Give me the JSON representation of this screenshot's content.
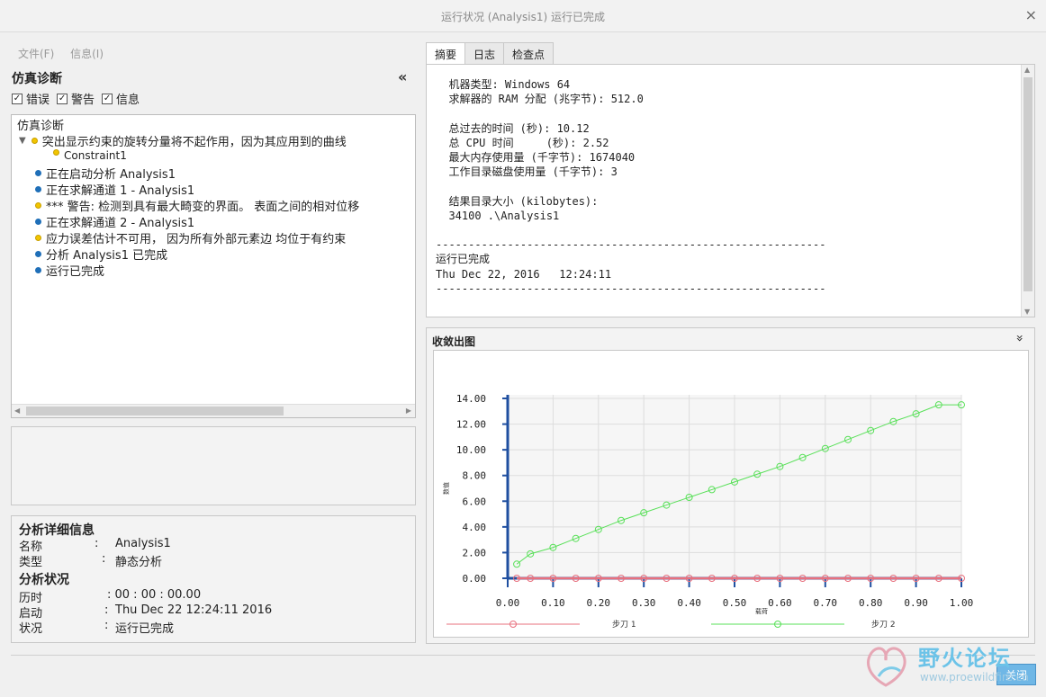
{
  "window": {
    "title": "运行状况 (Analysis1) 运行已完成",
    "close_glyph": "×"
  },
  "menu": {
    "file": "文件(F)",
    "info": "信息(I)"
  },
  "diagnostics": {
    "heading": "仿真诊断",
    "collapse_glyph": "«",
    "filters": {
      "errors": "错误",
      "warnings": "警告",
      "info": "信息"
    },
    "root": "仿真诊断",
    "items": [
      {
        "text": "突出显示约束的旋转分量将不起作用，因为其应用到的曲线",
        "kind": "warning"
      },
      {
        "text": "Constraint1",
        "kind": "warning"
      },
      {
        "text": "正在启动分析 Analysis1",
        "kind": "info"
      },
      {
        "text": "正在求解通道 1 - Analysis1",
        "kind": "info"
      },
      {
        "text": "*** 警告: 检测到具有最大畸变的界面。 表面之间的相对位移",
        "kind": "warning"
      },
      {
        "text": "正在求解通道 2 - Analysis1",
        "kind": "info"
      },
      {
        "text": " 应力误差估计不可用， 因为所有外部元素边 均位于有约束",
        "kind": "warning"
      },
      {
        "text": "分析 Analysis1 已完成",
        "kind": "info"
      },
      {
        "text": "运行已完成",
        "kind": "info"
      }
    ]
  },
  "details": {
    "heading": "分析详细信息",
    "name_label": "名称",
    "name_value": "Analysis1",
    "type_label": "类型",
    "type_value": "静态分析",
    "status_heading": "分析状况",
    "elapsed_label": "历时",
    "elapsed_value": ": 00 : 00 : 00.00",
    "start_label": "启动",
    "start_value": "Thu Dec 22 12:24:11 2016",
    "state_label": "状况",
    "state_value": "运行已完成",
    "colon": ":"
  },
  "tabs": {
    "summary": "摘要",
    "log": "日志",
    "checkpoints": "检查点"
  },
  "summary_text": "  机器类型: Windows 64\n  求解器的 RAM 分配 (兆字节): 512.0\n\n  总过去的时间 (秒): 10.12\n  总 CPU 时间     (秒): 2.52\n  最大内存使用量 (千字节): 1674040\n  工作目录磁盘使用量 (千字节): 3\n\n  结果目录大小 (kilobytes):\n  34100 .\\Analysis1\n\n------------------------------------------------------------\n运行已完成\nThu Dec 22, 2016   12:24:11\n------------------------------------------------------------",
  "convergence": {
    "title": "收敛出图",
    "collapse_glyph": "»"
  },
  "chart_data": {
    "type": "line",
    "xlabel": "载荷",
    "ylabel": "数值",
    "xlim": [
      0,
      1
    ],
    "ylim": [
      0,
      14
    ],
    "x_ticks": [
      "0.00",
      "0.10",
      "0.20",
      "0.30",
      "0.40",
      "0.50",
      "0.60",
      "0.70",
      "0.80",
      "0.90",
      "1.00"
    ],
    "y_ticks": [
      "0.00",
      "2.00",
      "4.00",
      "6.00",
      "8.00",
      "10.00",
      "12.00",
      "14.00"
    ],
    "grid": true,
    "series": [
      {
        "name": "步刀 1",
        "color": "#e8707e",
        "x": [
          0.02,
          0.05,
          0.1,
          0.15,
          0.2,
          0.25,
          0.3,
          0.35,
          0.4,
          0.45,
          0.5,
          0.55,
          0.6,
          0.65,
          0.7,
          0.75,
          0.8,
          0.85,
          0.9,
          0.95,
          1.0
        ],
        "y": [
          0,
          0,
          0,
          0,
          0,
          0,
          0,
          0,
          0,
          0,
          0,
          0,
          0,
          0,
          0,
          0,
          0,
          0,
          0,
          0,
          0
        ]
      },
      {
        "name": "步刀 2",
        "color": "#58e058",
        "x": [
          0.02,
          0.05,
          0.1,
          0.15,
          0.2,
          0.25,
          0.3,
          0.35,
          0.4,
          0.45,
          0.5,
          0.55,
          0.6,
          0.65,
          0.7,
          0.75,
          0.8,
          0.85,
          0.9,
          0.95,
          1.0
        ],
        "y": [
          1.1,
          1.9,
          2.4,
          3.1,
          3.8,
          4.5,
          5.1,
          5.7,
          6.3,
          6.9,
          7.5,
          8.1,
          8.7,
          9.4,
          10.1,
          10.8,
          11.5,
          12.2,
          12.8,
          13.5,
          13.5
        ]
      }
    ],
    "axis_color": "#1f4fa0"
  },
  "footer": {
    "close": "关闭"
  },
  "watermark": {
    "cn": "野火论坛",
    "en": "www.proewildfire.cn"
  }
}
